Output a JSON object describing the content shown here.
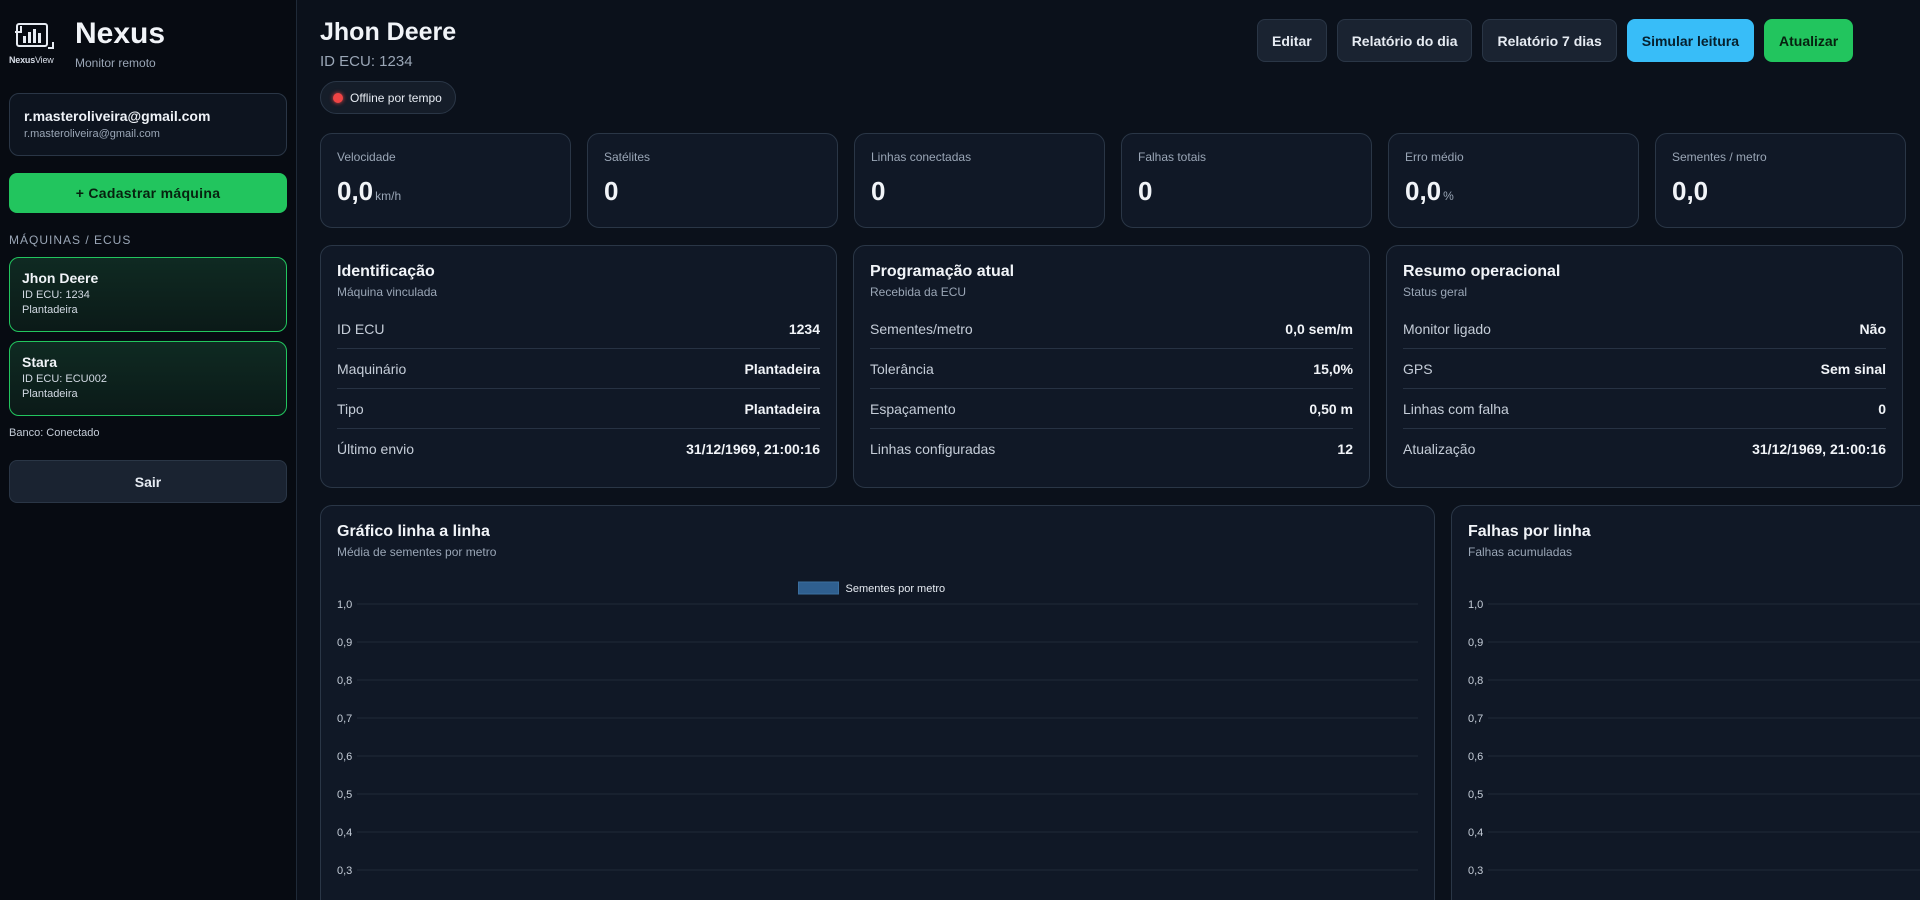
{
  "brand": {
    "title": "Nexus",
    "subtitle": "Monitor remoto",
    "logo_text_bold": "Nexus",
    "logo_text_light": "View"
  },
  "user": {
    "email": "r.masteroliveira@gmail.com",
    "email_sub": "r.masteroliveira@gmail.com"
  },
  "sidebar": {
    "register_label": "+ Cadastrar máquina",
    "section_label": "MÁQUINAS / ECUS",
    "machines": [
      {
        "name": "Jhon Deere",
        "ecu": "ID ECU: 1234",
        "type": "Plantadeira"
      },
      {
        "name": "Stara",
        "ecu": "ID ECU: ECU002",
        "type": "Plantadeira"
      }
    ],
    "db_status": "Banco: Conectado",
    "exit_label": "Sair"
  },
  "header": {
    "title": "Jhon Deere",
    "ecu_id": "ID ECU: 1234",
    "status": "Offline por tempo",
    "status_color": "#ef4444",
    "buttons": {
      "edit": "Editar",
      "report_day": "Relatório do dia",
      "report_week": "Relatório 7 dias",
      "simulate": "Simular leitura",
      "refresh": "Atualizar"
    }
  },
  "kpis": [
    {
      "label": "Velocidade",
      "value": "0,0",
      "unit": "km/h"
    },
    {
      "label": "Satélites",
      "value": "0",
      "unit": ""
    },
    {
      "label": "Linhas conectadas",
      "value": "0",
      "unit": ""
    },
    {
      "label": "Falhas totais",
      "value": "0",
      "unit": ""
    },
    {
      "label": "Erro médio",
      "value": "0,0",
      "unit": "%"
    },
    {
      "label": "Sementes / metro",
      "value": "0,0",
      "unit": ""
    }
  ],
  "panels": [
    {
      "title": "Identificação",
      "subtitle": "Máquina vinculada",
      "rows": [
        {
          "label": "ID ECU",
          "value": "1234"
        },
        {
          "label": "Maquinário",
          "value": "Plantadeira"
        },
        {
          "label": "Tipo",
          "value": "Plantadeira"
        },
        {
          "label": "Último envio",
          "value": "31/12/1969, 21:00:16"
        }
      ]
    },
    {
      "title": "Programação atual",
      "subtitle": "Recebida da ECU",
      "rows": [
        {
          "label": "Sementes/metro",
          "value": "0,0 sem/m"
        },
        {
          "label": "Tolerância",
          "value": "15,0%"
        },
        {
          "label": "Espaçamento",
          "value": "0,50 m"
        },
        {
          "label": "Linhas configuradas",
          "value": "12"
        }
      ]
    },
    {
      "title": "Resumo operacional",
      "subtitle": "Status geral",
      "rows": [
        {
          "label": "Monitor ligado",
          "value": "Não"
        },
        {
          "label": "GPS",
          "value": "Sem sinal"
        },
        {
          "label": "Linhas com falha",
          "value": "0"
        },
        {
          "label": "Atualização",
          "value": "31/12/1969, 21:00:16"
        }
      ]
    }
  ],
  "charts": {
    "left": {
      "title": "Gráfico linha a linha",
      "subtitle": "Média de sementes por metro"
    },
    "right": {
      "title": "Falhas por linha",
      "subtitle": "Falhas acumuladas"
    }
  },
  "chart_data": [
    {
      "type": "bar",
      "title": "Gráfico linha a linha",
      "subtitle": "Média de sementes por metro",
      "series": [
        {
          "name": "Sementes por metro",
          "color": "#2f5f8f",
          "values": []
        }
      ],
      "yticks": [
        "1,0",
        "0,9",
        "0,8",
        "0,7",
        "0,6",
        "0,5",
        "0,4",
        "0,3"
      ],
      "ylim": [
        0,
        1
      ],
      "legend": "top-center",
      "grid": true
    },
    {
      "type": "bar",
      "title": "Falhas por linha",
      "subtitle": "Falhas acumuladas",
      "series": [],
      "yticks": [
        "1,0",
        "0,9",
        "0,8",
        "0,7",
        "0,6",
        "0,5",
        "0,4",
        "0,3"
      ],
      "ylim": [
        0,
        1
      ],
      "legend": "none",
      "grid": true
    }
  ]
}
